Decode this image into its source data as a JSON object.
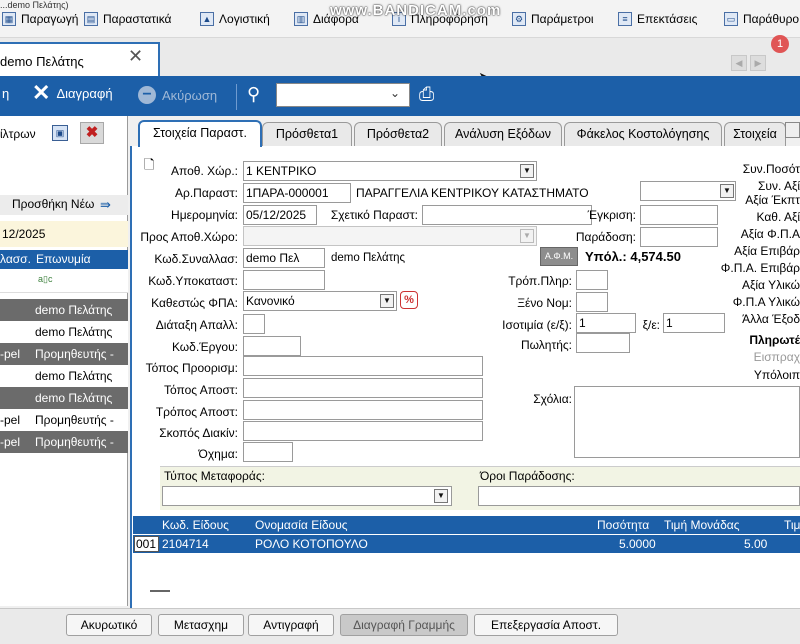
{
  "window_title_fragment": "...demo Πελάτης)",
  "watermark": "www.BANDICAM.com",
  "menu": {
    "items": [
      {
        "label": "Παραγωγή",
        "icon": "production-icon"
      },
      {
        "label": "Παραστατικά",
        "icon": "documents-icon"
      },
      {
        "label": "Λογιστική",
        "icon": "accounting-icon"
      },
      {
        "label": "Διάφορα",
        "icon": "misc-icon"
      },
      {
        "label": "Πληροφόρηση",
        "icon": "info-icon"
      },
      {
        "label": "Παράμετροι",
        "icon": "gear-icon"
      },
      {
        "label": "Επεκτάσεις",
        "icon": "extensions-icon"
      },
      {
        "label": "Παράθυρο",
        "icon": "window-icon"
      }
    ]
  },
  "doc_tab": {
    "label": "demo Πελάτης",
    "close": "✕"
  },
  "notification_count": "1",
  "toolbar": {
    "save_partial": "η",
    "delete_label": "Διαγραφή",
    "cancel_label": "Ακύρωση",
    "search_value": ""
  },
  "left_panel": {
    "filters_label": "ίλτρων",
    "add_new_label": "Προσθήκη Νέω",
    "date_value": "12/2025",
    "columns": [
      "λασσ.",
      "Επωνυμία"
    ],
    "rows": [
      {
        "code": "",
        "name": "demo Πελάτης",
        "selected": true
      },
      {
        "code": "",
        "name": "demo Πελάτης",
        "selected": false
      },
      {
        "code": "-pel",
        "name": "Προμηθευτής -",
        "selected": true
      },
      {
        "code": "",
        "name": "demo Πελάτης",
        "selected": false
      },
      {
        "code": "",
        "name": "demo Πελάτης",
        "selected": true
      },
      {
        "code": "-pel",
        "name": "Προμηθευτής -",
        "selected": false
      },
      {
        "code": "-pel",
        "name": "Προμηθευτής -",
        "selected": true
      }
    ]
  },
  "form_tabs": [
    "Στοιχεία Παραστ.",
    "Πρόσθετα1",
    "Πρόσθετα2",
    "Ανάλυση Εξόδων",
    "Φάκελος Κοστολόγησης",
    "Στοιχεία"
  ],
  "form": {
    "warehouse_label": "Αποθ. Χώρ.:",
    "warehouse_value": "1  ΚΕΝΤΡΙΚΟ",
    "doc_no_label": "Αρ.Παραστ:",
    "doc_no_value": "1ΠΑΡΑ-000001",
    "doc_type_value": "ΠΑΡΑΓΓΕΛΙΑ ΚΕΝΤΡΙΚΟΥ ΚΑΤΑΣΤΗΜΑΤΟ",
    "date_label": "Ημερομηνία:",
    "date_value": "05/12/2025",
    "related_label": "Σχετικό Παραστ:",
    "to_warehouse_label": "Προς Αποθ.Χώρο:",
    "counterparty_label": "Κωδ.Συναλλασ:",
    "counterparty_code": "demo Πελ",
    "counterparty_name": "demo Πελάτης",
    "branch_label": "Κωδ.Υποκαταστ:",
    "vat_status_label": "Καθεστώς ΦΠΑ:",
    "vat_status_value": "Κανονικό",
    "vat_icon": "%",
    "exemption_label": "Διάταξη Απαλλ:",
    "project_label": "Κωδ.Έργου:",
    "destination_label": "Τόπος Προορισμ:",
    "dispatch_place_label": "Τόπος Αποστ:",
    "dispatch_method_label": "Τρόπος Αποστ:",
    "shipping_purpose_label": "Σκοπός Διακίν:",
    "vehicle_label": "Όχημα:",
    "approval_label": "Έγκριση:",
    "delivery_label": "Παράδοση:",
    "afm_label": "Α.Φ.Μ.",
    "balance_text": "Υπόλ.: 4,574.50",
    "payment_method_label": "Τρόπ.Πληρ:",
    "currency_label": "Ξένο Νομ:",
    "parity_label": "Ισοτιμία (ε/ξ):",
    "parity_value": "1",
    "parity2_label": "ξ/ε:",
    "parity2_value": "1",
    "salesman_label": "Πωλητής:",
    "comments_label": "Σχόλια:",
    "transport_type_label": "Τύπος Μεταφοράς:",
    "delivery_terms_label": "Όροι Παράδοσης:"
  },
  "summary_labels": [
    "Συν.Ποσότ",
    "Συν. Αξί",
    "Αξία Έκπτ",
    "Καθ. Αξί",
    "Αξία Φ.Π.Α",
    "Αξία Επιβάρ",
    "Φ.Π.Α. Επιβάρ",
    "Αξία Υλικώ",
    "Φ.Π.Α Υλικώ",
    "Άλλα Έξοδ",
    "Πληρωτέ",
    "Εισπραχ",
    "Υπόλοιπ"
  ],
  "items": {
    "columns": [
      "Κωδ. Είδους",
      "Ονομασία Είδους",
      "Ποσότητα",
      "Τιμή Μονάδας",
      "Τιμ"
    ],
    "rows": [
      {
        "index": "001",
        "code": "2104714",
        "name": "ΡΟΛΟ ΚΟΤΟΠΟΥΛΟ",
        "qty": "5.0000",
        "price": "5.00"
      }
    ]
  },
  "bottom_buttons": [
    {
      "label": "Ακυρωτικό",
      "disabled": false
    },
    {
      "label": "Μετασχημ",
      "disabled": false
    },
    {
      "label": "Αντιγραφή",
      "disabled": false
    },
    {
      "label": "Διαγραφή Γραμμής",
      "disabled": true
    },
    {
      "label": "Επεξεργασία Αποστ.",
      "disabled": false
    }
  ]
}
